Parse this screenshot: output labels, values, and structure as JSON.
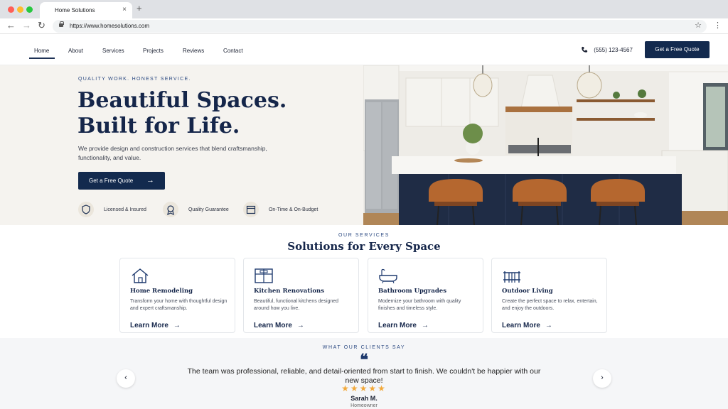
{
  "browser": {
    "tab_title": "Home Solutions",
    "tab_close": "×",
    "new_tab": "+",
    "url": "https://www.homesolutions.com",
    "traffic_lights": [
      "#ff5f57",
      "#febc2e",
      "#28c840"
    ]
  },
  "nav": {
    "links": [
      "Home",
      "About",
      "Services",
      "Projects",
      "Reviews",
      "Contact"
    ],
    "active": "Home",
    "phone": "(555) 123-4567",
    "cta": "Get a Free Quote"
  },
  "hero": {
    "eyebrow": "QUALITY WORK. HONEST SERVICE.",
    "title_line1": "Beautiful Spaces.",
    "title_line2": "Built for Life.",
    "subtitle": "We provide design and construction services that blend craftsmanship, functionality, and value.",
    "cta": "Get a Free Quote",
    "cta_icon": "arrow-right-icon",
    "badges": [
      {
        "icon": "shield-icon",
        "label": "Licensed & Insured"
      },
      {
        "icon": "award-icon",
        "label": "Quality Guarantee"
      },
      {
        "icon": "calendar-icon",
        "label": "On-Time & On-Budget"
      }
    ],
    "image_alt": "kitchen-photo"
  },
  "services": {
    "eyebrow": "OUR SERVICES",
    "title": "Solutions for Every Space",
    "cards": [
      {
        "icon": "house-icon",
        "title": "Home Remodeling",
        "desc": "Transform your home with thoughtful design and expert craftsmanship.",
        "link": "Learn More"
      },
      {
        "icon": "kitchen-icon",
        "title": "Kitchen Renovations",
        "desc": "Beautiful, functional kitchens designed around how you live.",
        "link": "Learn More"
      },
      {
        "icon": "bathtub-icon",
        "title": "Bathroom Upgrades",
        "desc": "Modernize your bathroom with quality finishes and timeless style.",
        "link": "Learn More"
      },
      {
        "icon": "fence-icon",
        "title": "Outdoor Living",
        "desc": "Create the perfect space to relax, entertain, and enjoy the outdoors.",
        "link": "Learn More"
      }
    ]
  },
  "testimonials": {
    "eyebrow": "WHAT OUR CLIENTS SAY",
    "quote_mark": "❝",
    "quote": "The team was professional, reliable, and detail-oriented from start to finish. We couldn't be happier with our new space!",
    "rating": 5,
    "stars": "★★★★★",
    "author": "Sarah M.",
    "role": "Homeowner",
    "prev": "‹",
    "next": "›"
  },
  "colors": {
    "brand_navy": "#132a4e",
    "accent_blue": "#2c4a82",
    "star": "#f2a93b",
    "hero_bg": "#f5f3ef"
  }
}
